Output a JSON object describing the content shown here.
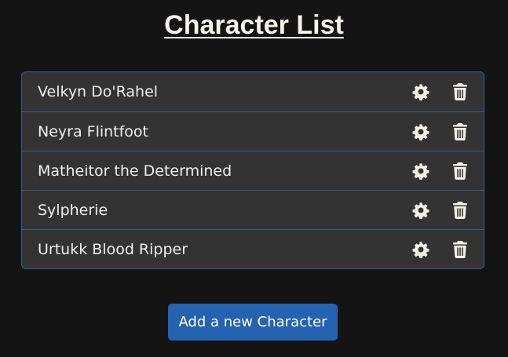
{
  "page": {
    "title": "Character List"
  },
  "characters": [
    {
      "name": "Velkyn Do'Rahel"
    },
    {
      "name": "Neyra Flintfoot"
    },
    {
      "name": "Matheitor the Determined"
    },
    {
      "name": "Sylpherie"
    },
    {
      "name": "Urtukk Blood Ripper"
    }
  ],
  "row_actions": {
    "settings_icon": "gear-icon",
    "delete_icon": "trash-icon"
  },
  "actions": {
    "add_label": "Add a new Character"
  },
  "colors": {
    "background": "#141414",
    "row_background": "#333333",
    "row_border": "#2d5f94",
    "button": "#2563b0",
    "icon": "#f3efe4"
  }
}
